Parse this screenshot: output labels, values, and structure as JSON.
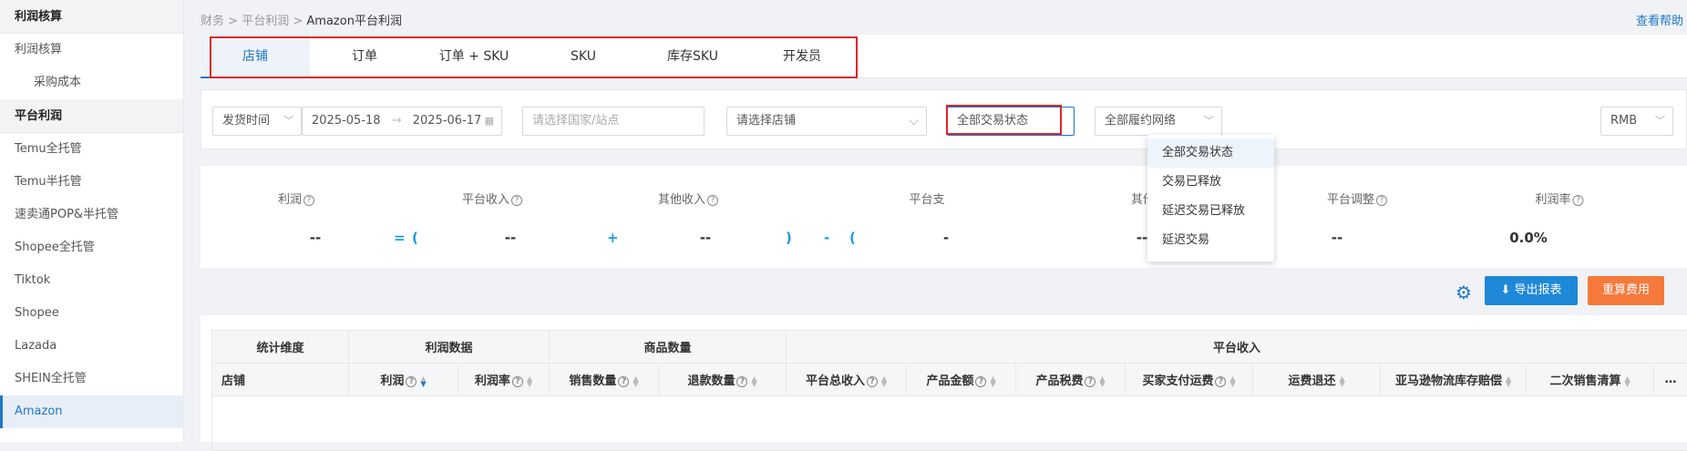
{
  "sidebar": {
    "groups": [
      {
        "title": "利润核算",
        "items": [
          {
            "label": "利润核算"
          },
          {
            "label": "采购成本"
          }
        ]
      },
      {
        "title": "平台利润",
        "items": [
          {
            "label": "Temu全托管"
          },
          {
            "label": "Temu半托管"
          },
          {
            "label": "速卖通POP&半托管"
          },
          {
            "label": "Shopee全托管"
          },
          {
            "label": "Tiktok"
          },
          {
            "label": "Shopee"
          },
          {
            "label": "Lazada"
          },
          {
            "label": "SHEIN全托管"
          },
          {
            "label": "Amazon"
          }
        ]
      }
    ]
  },
  "breadcrumb": {
    "items": [
      "财务",
      "平台利润"
    ],
    "current": "Amazon平台利润",
    "sep": ">"
  },
  "help_label": "查看帮助",
  "tabs": [
    {
      "label": "店铺"
    },
    {
      "label": "订单"
    },
    {
      "label": "订单 + SKU"
    },
    {
      "label": "SKU"
    },
    {
      "label": "库存SKU"
    },
    {
      "label": "开发员"
    }
  ],
  "filters": {
    "date_type": "发货时间",
    "date_start": "2025-05-18",
    "date_arrow": "→",
    "date_end": "2025-06-17",
    "country_placeholder": "请选择国家/站点",
    "shop_placeholder": "请选择店铺",
    "trade_status": "全部交易状态",
    "fulfillment": "全部履约网络",
    "currency": "RMB"
  },
  "dropdown": {
    "options": [
      "全部交易状态",
      "交易已释放",
      "延迟交易已释放",
      "延迟交易"
    ]
  },
  "summary": {
    "metrics": [
      {
        "label": "利润",
        "value": "--"
      },
      {
        "label": "平台收入",
        "value": "--"
      },
      {
        "label": "其他收入",
        "value": "--"
      },
      {
        "label": "平台支",
        "value": "-"
      },
      {
        "label": "其他支出",
        "value": "--"
      },
      {
        "label": "平台调整",
        "value": "--"
      },
      {
        "label": "利润率",
        "value": "0.0%"
      }
    ],
    "operators": [
      "=",
      "(",
      "+",
      ")",
      "-",
      "(",
      ")",
      "+"
    ]
  },
  "actions": {
    "export": "导出报表",
    "recalc": "重算费用"
  },
  "table": {
    "group_headers": [
      "统计维度",
      "利润数据",
      "商品数量",
      "平台收入"
    ],
    "columns": [
      "店铺",
      "利润",
      "利润率",
      "销售数量",
      "退款数量",
      "平台总收入",
      "产品金额",
      "产品税费",
      "买家支付运费",
      "运费退还",
      "亚马逊物流库存赔偿",
      "二次销售清算",
      "…"
    ]
  },
  "colors": {
    "accent": "#1e78c9",
    "export_button": "#1e88d9",
    "recalc_button": "#f5793b",
    "highlight_box": "#e0242b"
  }
}
